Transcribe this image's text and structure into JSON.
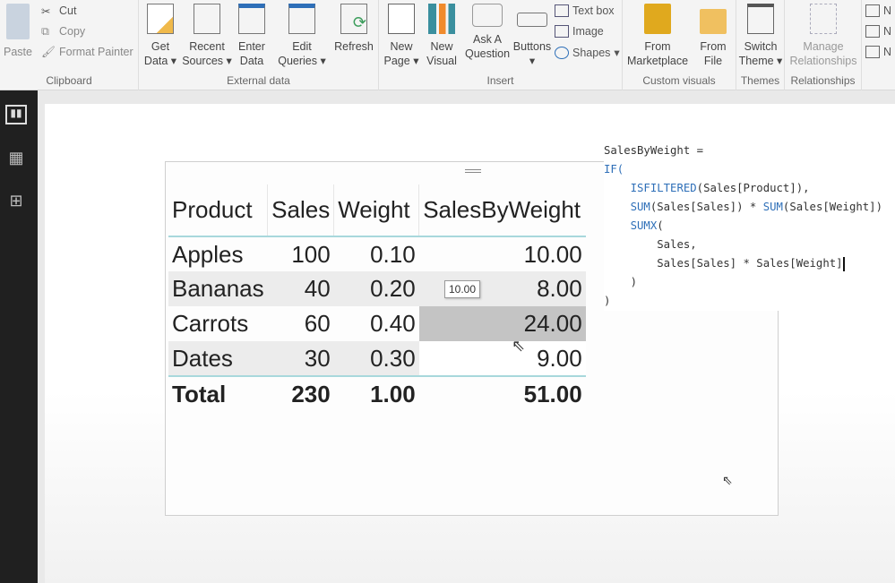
{
  "ribbon": {
    "clipboard": {
      "label": "Clipboard",
      "paste": "Paste",
      "cut": "Cut",
      "copy": "Copy",
      "format_painter": "Format Painter"
    },
    "external_data": {
      "label": "External data",
      "get_data": [
        "Get",
        "Data"
      ],
      "recent_sources": [
        "Recent",
        "Sources"
      ],
      "enter_data": [
        "Enter",
        "Data"
      ],
      "edit_queries": [
        "Edit",
        "Queries"
      ],
      "refresh": "Refresh"
    },
    "insert": {
      "label": "Insert",
      "new_page": [
        "New",
        "Page"
      ],
      "new_visual": [
        "New",
        "Visual"
      ],
      "ask_question": [
        "Ask A",
        "Question"
      ],
      "buttons": "Buttons",
      "text_box": "Text box",
      "image": "Image",
      "shapes": "Shapes"
    },
    "custom_visuals": {
      "label": "Custom visuals",
      "from_marketplace": [
        "From",
        "Marketplace"
      ],
      "from_file": [
        "From",
        "File"
      ]
    },
    "themes": {
      "label": "Themes",
      "switch_theme": [
        "Switch",
        "Theme"
      ]
    },
    "relationships": {
      "label": "Relationships",
      "manage": [
        "Manage",
        "Relationships"
      ]
    },
    "calculations": [
      "N",
      "N",
      "N"
    ]
  },
  "sidebar": [
    "report-view",
    "data-view",
    "model-view"
  ],
  "table": {
    "headers": [
      "Product",
      "Sales",
      "Weight",
      "SalesByWeight"
    ],
    "rows": [
      [
        "Apples",
        "100",
        "0.10",
        "10.00"
      ],
      [
        "Bananas",
        "40",
        "0.20",
        "8.00"
      ],
      [
        "Carrots",
        "60",
        "0.40",
        "24.00"
      ],
      [
        "Dates",
        "30",
        "0.30",
        "9.00"
      ]
    ],
    "total": [
      "Total",
      "230",
      "1.00",
      "51.00"
    ],
    "tooltip": "10.00"
  },
  "formula": {
    "l1": "SalesByWeight =",
    "l2": "IF(",
    "l3a": "ISFILTERED",
    "l3b": "(Sales[Product]),",
    "l4a": "SUM",
    "l4b": "(Sales[Sales]) * ",
    "l4c": "SUM",
    "l4d": "(Sales[Weight])",
    "l5a": "SUMX",
    "l5b": "(",
    "l6": "Sales,",
    "l7": "Sales[Sales] * Sales[Weight]",
    "l8": ")",
    "l9": ")"
  },
  "colors": {
    "accent": "#a8d8dc",
    "keyword": "#2e6fb8",
    "sidebar": "#202020"
  }
}
